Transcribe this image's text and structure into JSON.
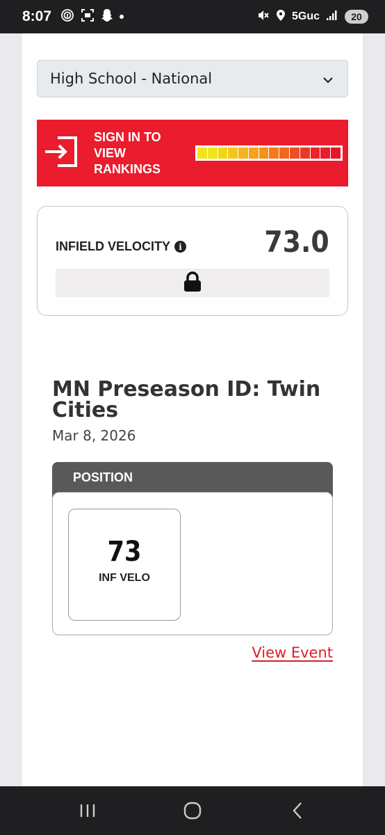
{
  "status_bar": {
    "time": "8:07",
    "network": "5Guc",
    "battery": "20"
  },
  "filter": {
    "selected": "High School - National"
  },
  "signin_banner": {
    "text": "SIGN IN TO VIEW RANKINGS",
    "rank_colors": [
      "#f1e41d",
      "#f1e41d",
      "#f2d61c",
      "#f4c51b",
      "#f5b41b",
      "#f6a21b",
      "#f6911c",
      "#f47b1d",
      "#f1671f",
      "#ee4f22",
      "#eb3826",
      "#ea2429",
      "#ea1c2d",
      "#e9142b"
    ]
  },
  "metric_card": {
    "label": "INFIELD VELOCITY",
    "value": "73.0"
  },
  "event": {
    "title": "MN Preseason ID: Twin Cities",
    "date": "Mar 8, 2026",
    "section_header": "POSITION",
    "stat_value": "73",
    "stat_label": "INF VELO",
    "link": "View Event"
  },
  "colors": {
    "accent_red": "#ea1c2d",
    "link_red": "#d91f2a",
    "header_gray": "#595959"
  }
}
